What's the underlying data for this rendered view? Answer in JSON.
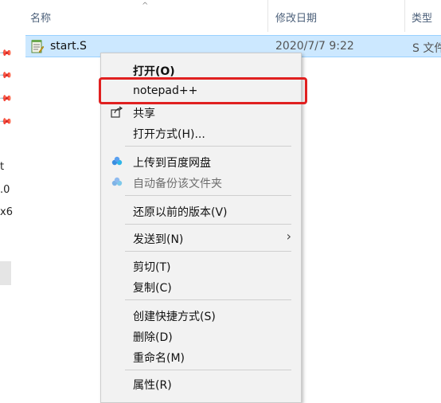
{
  "columns": {
    "name": "名称",
    "date_modified": "修改日期",
    "type": "类型"
  },
  "file": {
    "name": "start.S",
    "date": "2020/7/7 9:22",
    "type": "S 文件"
  },
  "left_fragments": [
    "t",
    ".0",
    "x6"
  ],
  "context_menu": {
    "open": "打开(O)",
    "notepadpp": "notepad++",
    "share": "共享",
    "open_with": "打开方式(H)...",
    "upload_baidu": "上传到百度网盘",
    "auto_backup": "自动备份该文件夹",
    "restore_versions": "还原以前的版本(V)",
    "send_to": "发送到(N)",
    "cut": "剪切(T)",
    "copy": "复制(C)",
    "create_shortcut": "创建快捷方式(S)",
    "delete": "删除(D)",
    "rename": "重命名(M)",
    "properties": "属性(R)"
  },
  "colors": {
    "highlight": "#e02020",
    "selection": "#cce8ff",
    "menu_bg": "#f2f2f2"
  },
  "icons": [
    "pin-icon",
    "notepad-file-icon",
    "share-icon",
    "baidu-cloud-icon",
    "chevron-right-icon",
    "sort-up-icon"
  ]
}
